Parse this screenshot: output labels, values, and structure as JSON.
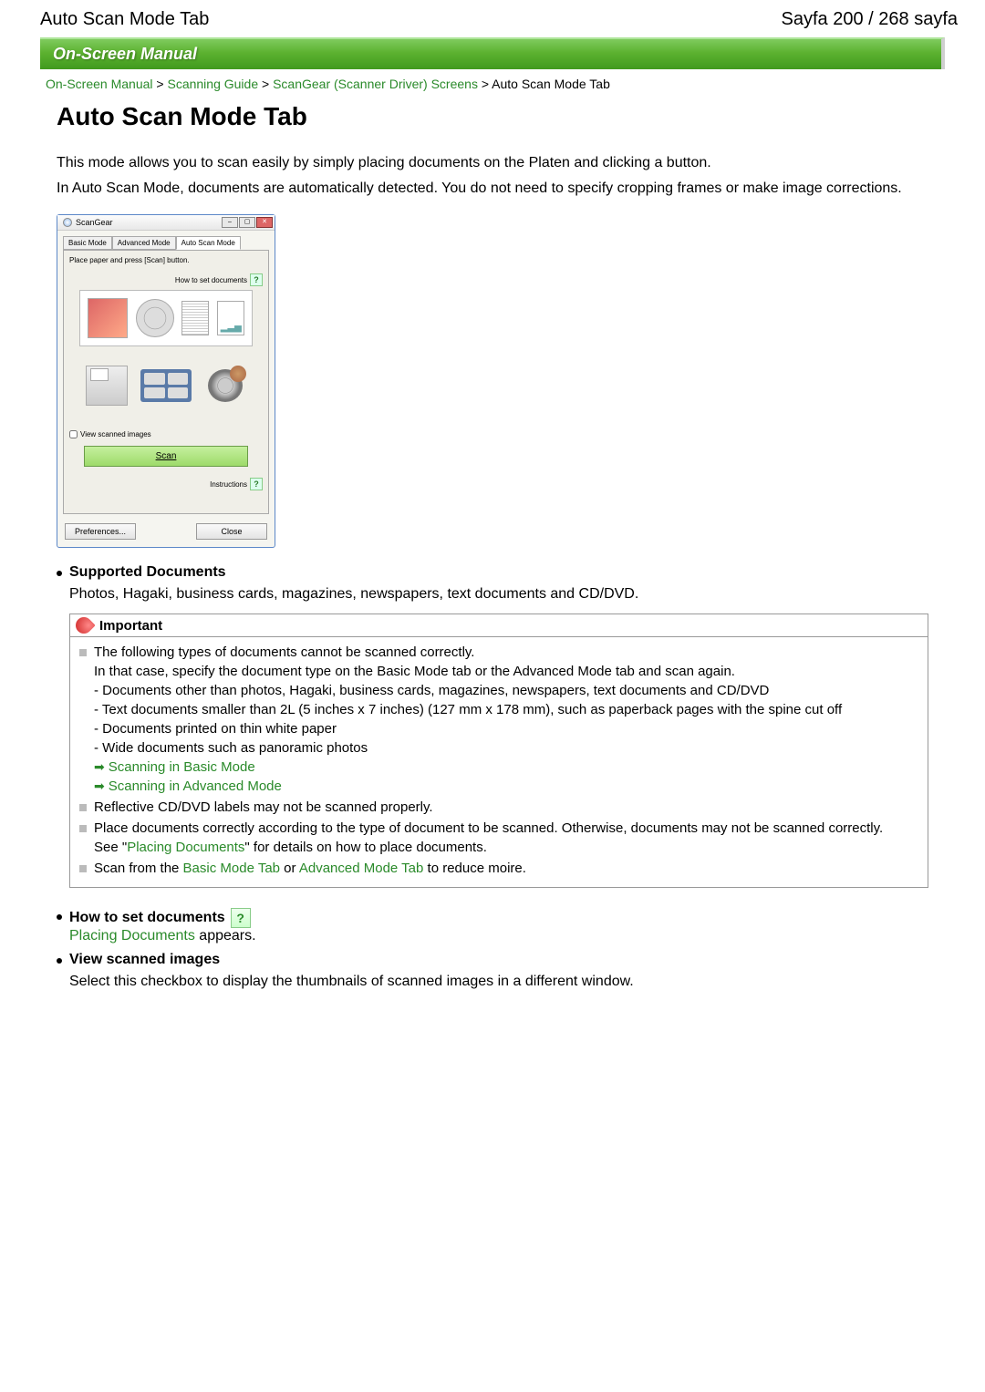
{
  "header": {
    "left": "Auto Scan Mode Tab",
    "right": "Sayfa 200 / 268 sayfa"
  },
  "banner": "On-Screen Manual",
  "breadcrumb": {
    "items": [
      "On-Screen Manual",
      "Scanning Guide",
      "ScanGear (Scanner Driver) Screens"
    ],
    "current": "Auto Scan Mode Tab",
    "sep": " > "
  },
  "title": "Auto Scan Mode Tab",
  "intro": {
    "p1": "This mode allows you to scan easily by simply placing documents on the Platen and clicking a button.",
    "p2": "In Auto Scan Mode, documents are automatically detected. You do not need to specify cropping frames or make image corrections."
  },
  "screenshot": {
    "window_title": "ScanGear",
    "tabs": {
      "basic": "Basic Mode",
      "advanced": "Advanced Mode",
      "auto": "Auto Scan Mode"
    },
    "instruction": "Place paper and press [Scan] button.",
    "how_to_set": "How to set documents",
    "view_checkbox": "View scanned images",
    "scan_btn": "Scan",
    "instructions_label": "Instructions",
    "preferences_btn": "Preferences...",
    "close_btn": "Close"
  },
  "sections": {
    "supported": {
      "title": "Supported Documents",
      "text": "Photos, Hagaki, business cards, magazines, newspapers, text documents and CD/DVD."
    },
    "important": {
      "label": "Important",
      "li1": {
        "a": "The following types of documents cannot be scanned correctly.",
        "b": "In that case, specify the document type on the Basic Mode tab or the Advanced Mode tab and scan again.",
        "c": "- Documents other than photos, Hagaki, business cards, magazines, newspapers, text documents and CD/DVD",
        "d": "- Text documents smaller than 2L (5 inches x 7 inches) (127 mm x 178 mm), such as paperback pages with the spine cut off",
        "e": "- Documents printed on thin white paper",
        "f": "- Wide documents such as panoramic photos",
        "link1": "Scanning in Basic Mode",
        "link2": "Scanning in Advanced Mode"
      },
      "li2": "Reflective CD/DVD labels may not be scanned properly.",
      "li3": {
        "a": "Place documents correctly according to the type of document to be scanned. Otherwise, documents may not be scanned correctly.",
        "b_pre": "See \"",
        "b_link": "Placing Documents",
        "b_post": "\" for details on how to place documents."
      },
      "li4": {
        "pre": "Scan from the ",
        "l1": "Basic Mode Tab",
        "mid": " or ",
        "l2": "Advanced Mode Tab",
        "post": " to reduce moire."
      }
    },
    "howto": {
      "title": "How to set documents",
      "link": "Placing Documents",
      "post": " appears."
    },
    "view": {
      "title": "View scanned images",
      "text": "Select this checkbox to display the thumbnails of scanned images in a different window."
    }
  }
}
